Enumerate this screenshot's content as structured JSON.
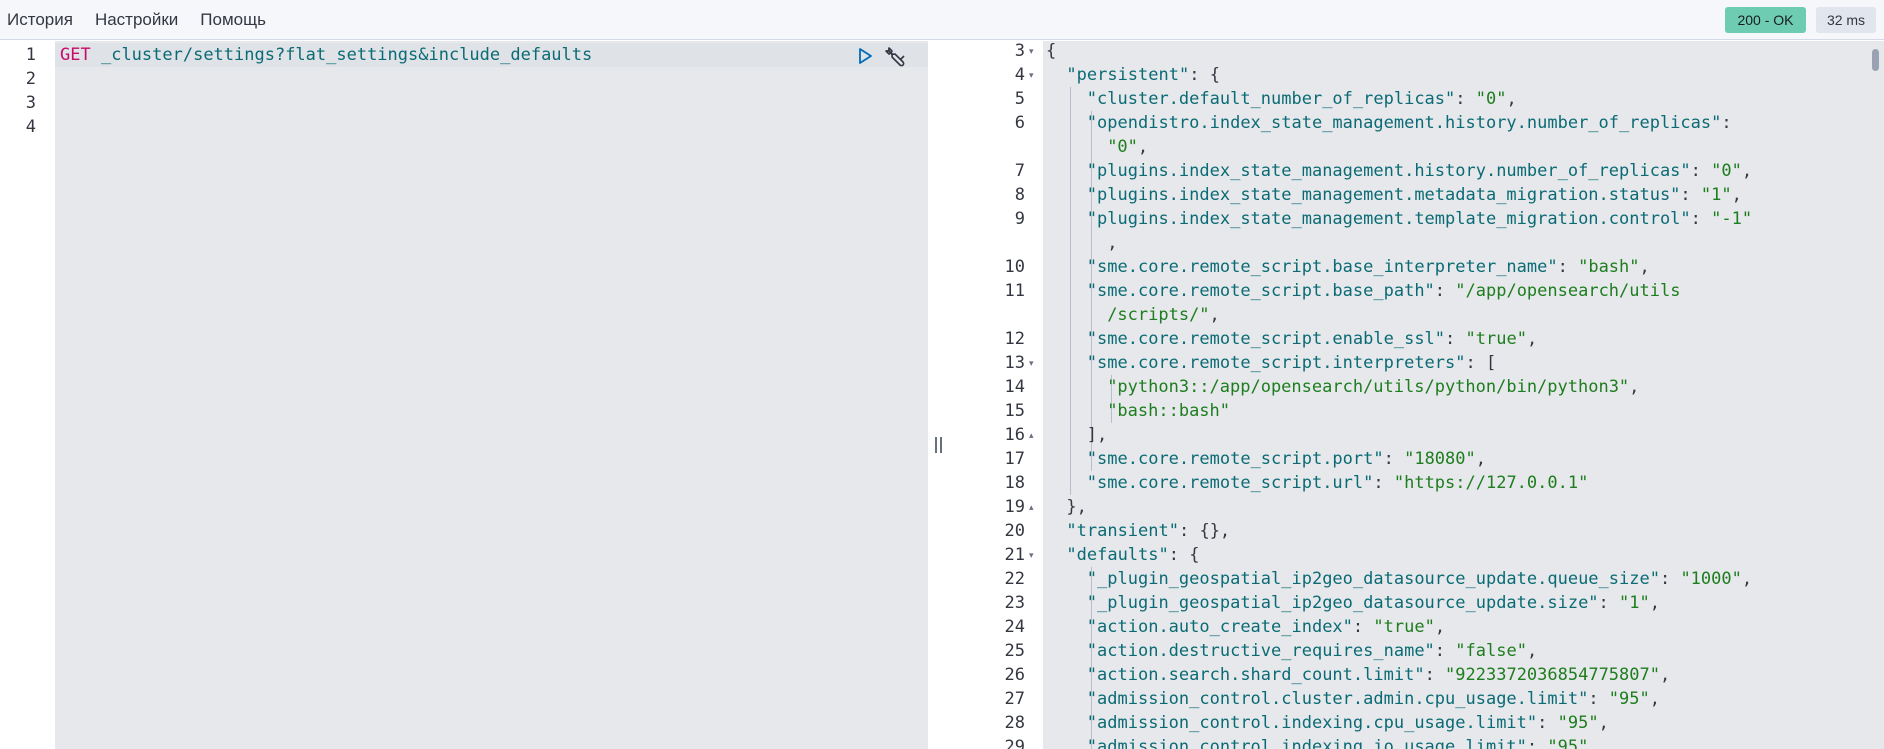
{
  "menu": {
    "history": "История",
    "settings": "Настройки",
    "help": "Помощь"
  },
  "status": {
    "code": "200 - OK",
    "time": "32 ms",
    "ok_color": "#6dccb1"
  },
  "request": {
    "line_numbers": [
      "1",
      "2",
      "3",
      "4"
    ],
    "method": "GET",
    "url": "_cluster/settings?flat_settings&include_defaults",
    "run_icon": "play-icon",
    "tools_icon": "wrench-icon"
  },
  "response": {
    "line_numbers": [
      "3",
      "4",
      "5",
      "6",
      "7",
      "8",
      "9",
      "10",
      "11",
      "12",
      "13",
      "14",
      "15",
      "16",
      "17",
      "18",
      "19",
      "20",
      "21",
      "22",
      "23",
      "24",
      "25",
      "26",
      "27",
      "28",
      "29"
    ],
    "lines": [
      {
        "open": "{"
      },
      {
        "key": "\"persistent\"",
        "sep": ": {"
      },
      {
        "key": "\"cluster.default_number_of_replicas\"",
        "sep": ": ",
        "val": "\"0\"",
        "end": ","
      },
      {
        "key": "\"opendistro.index_state_management.history.number_of_replicas\"",
        "sep": ":"
      },
      {
        "val": "\"0\"",
        "end": ","
      },
      {
        "key": "\"plugins.index_state_management.history.number_of_replicas\"",
        "sep": ": ",
        "val": "\"0\"",
        "end": ","
      },
      {
        "key": "\"plugins.index_state_management.metadata_migration.status\"",
        "sep": ": ",
        "val": "\"1\"",
        "end": ","
      },
      {
        "key": "\"plugins.index_state_management.template_migration.control\"",
        "sep": ": ",
        "val": "\"-1\""
      },
      {
        "end": ","
      },
      {
        "key": "\"sme.core.remote_script.base_interpreter_name\"",
        "sep": ": ",
        "val": "\"bash\"",
        "end": ","
      },
      {
        "key": "\"sme.core.remote_script.base_path\"",
        "sep": ": ",
        "val": "\"/app/opensearch/utils"
      },
      {
        "val": "/scripts/\"",
        "end": ","
      },
      {
        "key": "\"sme.core.remote_script.enable_ssl\"",
        "sep": ": ",
        "val": "\"true\"",
        "end": ","
      },
      {
        "key": "\"sme.core.remote_script.interpreters\"",
        "sep": ": ["
      },
      {
        "val": "\"python3::/app/opensearch/utils/python/bin/python3\"",
        "end": ","
      },
      {
        "val": "\"bash::bash\""
      },
      {
        "end": "],"
      },
      {
        "key": "\"sme.core.remote_script.port\"",
        "sep": ": ",
        "val": "\"18080\"",
        "end": ","
      },
      {
        "key": "\"sme.core.remote_script.url\"",
        "sep": ": ",
        "val": "\"https://127.0.0.1\""
      },
      {
        "end": "},"
      },
      {
        "key": "\"transient\"",
        "sep": ": {},"
      },
      {
        "key": "\"defaults\"",
        "sep": ": {"
      },
      {
        "key": "\"_plugin_geospatial_ip2geo_datasource_update.queue_size\"",
        "sep": ": ",
        "val": "\"1000\"",
        "end": ","
      },
      {
        "key": "\"_plugin_geospatial_ip2geo_datasource_update.size\"",
        "sep": ": ",
        "val": "\"1\"",
        "end": ","
      },
      {
        "key": "\"action.auto_create_index\"",
        "sep": ": ",
        "val": "\"true\"",
        "end": ","
      },
      {
        "key": "\"action.destructive_requires_name\"",
        "sep": ": ",
        "val": "\"false\"",
        "end": ","
      },
      {
        "key": "\"action.search.shard_count.limit\"",
        "sep": ": ",
        "val": "\"9223372036854775807\"",
        "end": ","
      },
      {
        "key": "\"admission_control.cluster.admin.cpu_usage.limit\"",
        "sep": ": ",
        "val": "\"95\"",
        "end": ","
      },
      {
        "key": "\"admission_control.indexing.cpu_usage.limit\"",
        "sep": ": ",
        "val": "\"95\"",
        "end": ","
      },
      {
        "key": "\"admission_control.indexing.io_usage.limit\"",
        "sep": ": ",
        "val": "\"95\""
      }
    ]
  }
}
